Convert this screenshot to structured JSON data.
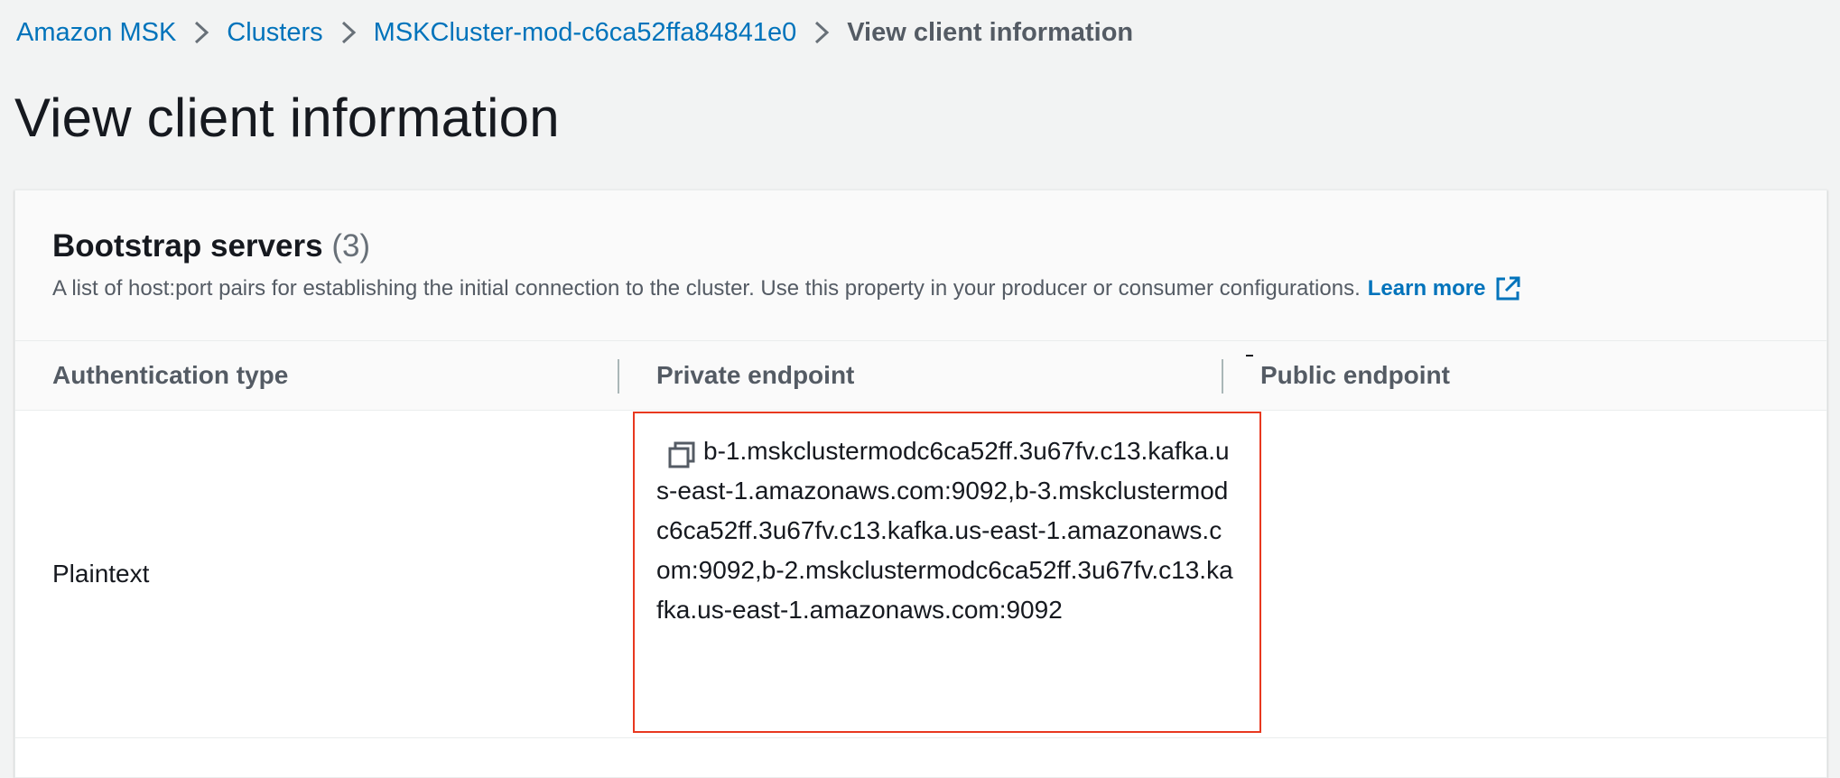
{
  "breadcrumb": {
    "items": [
      {
        "label": "Amazon MSK"
      },
      {
        "label": "Clusters"
      },
      {
        "label": "MSKCluster-mod-c6ca52ffa84841e0"
      }
    ],
    "current": "View client information"
  },
  "page": {
    "title": "View client information"
  },
  "bootstrap": {
    "title": "Bootstrap servers",
    "count": "(3)",
    "description": "A list of host:port pairs for establishing the initial connection to the cluster. Use this property in your producer or consumer configurations.",
    "learn_more": "Learn more"
  },
  "table": {
    "columns": [
      "Authentication type",
      "Private endpoint",
      "Public endpoint"
    ],
    "rows": [
      {
        "auth": "Plaintext",
        "private_endpoint": "b-1.mskclustermodc6ca52ff.3u67fv.c13.kafka.us-east-1.amazonaws.com:9092,b-3.mskclustermodc6ca52ff.3u67fv.c13.kafka.us-east-1.amazonaws.com:9092,b-2.mskclustermodc6ca52ff.3u67fv.c13.kafka.us-east-1.amazonaws.com:9092",
        "public_endpoint": ""
      }
    ]
  },
  "icons": {
    "separator": "chevron-right-icon",
    "external": "external-link-icon",
    "copy": "copy-icon"
  },
  "colors": {
    "link": "#0073bb",
    "highlight": "#e8381f"
  }
}
